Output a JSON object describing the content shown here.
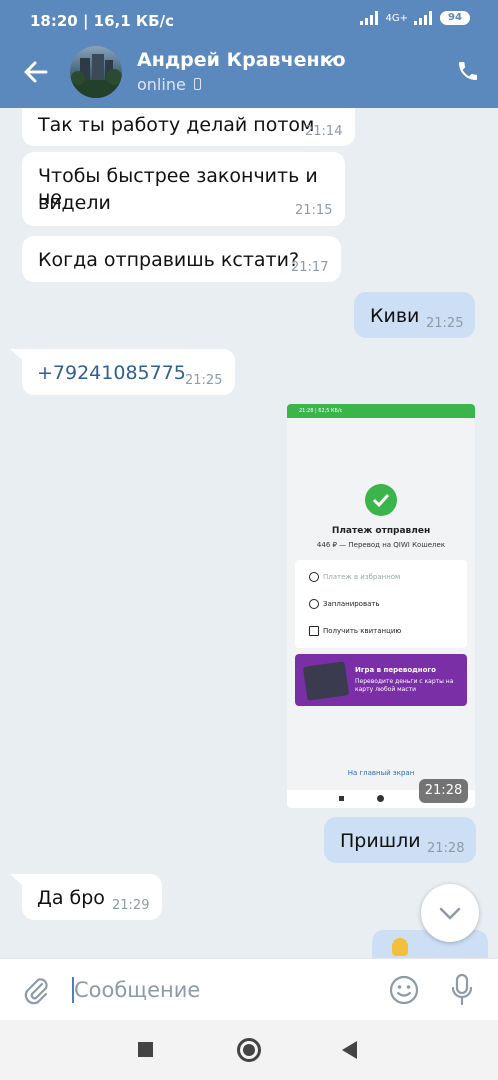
{
  "status_bar": {
    "time": "18:20 | 16,1 КБ/с",
    "network": "4G+",
    "battery": "94"
  },
  "header": {
    "contact_name": "Андрей Кравченко",
    "presence": "online",
    "icons": [
      "back-arrow-icon",
      "avatar",
      "chevron-down-icon",
      "phone-device-icon",
      "call-icon"
    ]
  },
  "messages": [
    {
      "dir": "in",
      "text": "Так ты работу делай потом",
      "time": "21:14"
    },
    {
      "dir": "in",
      "text_line1": "Чтобы быстрее закончить и не",
      "text_line2": "видели",
      "time": "21:15"
    },
    {
      "dir": "in",
      "text": "Когда отправишь кстати?",
      "time": "21:17"
    },
    {
      "dir": "out",
      "text": "Киви",
      "time": "21:25"
    },
    {
      "dir": "in",
      "text": "+79241085775",
      "time": "21:25"
    },
    {
      "dir": "out",
      "type": "image",
      "time": "21:28"
    },
    {
      "dir": "out",
      "text": "Пришли",
      "time": "21:28"
    },
    {
      "dir": "in",
      "text": "Да бро",
      "time": "21:29"
    }
  ],
  "screenshot": {
    "status": "21:28 | 62,5 КБ/с",
    "title": "Платеж отправлен",
    "subtitle": "446 ₽ — Перевод на QIWI Кошелек",
    "rows": [
      "Платеж в избранном",
      "Запланировать",
      "Получить квитанцию"
    ],
    "promo_title": "Игра в переводного",
    "promo_text": "Переводите деньги с карты на карту любой масти",
    "home_link": "На главный экран"
  },
  "composer": {
    "placeholder": "Сообщение",
    "value": ""
  },
  "colors": {
    "header": "#5b88bd",
    "outgoing": "#cddff4",
    "incoming": "#ffffff",
    "background": "#e9eef3"
  }
}
